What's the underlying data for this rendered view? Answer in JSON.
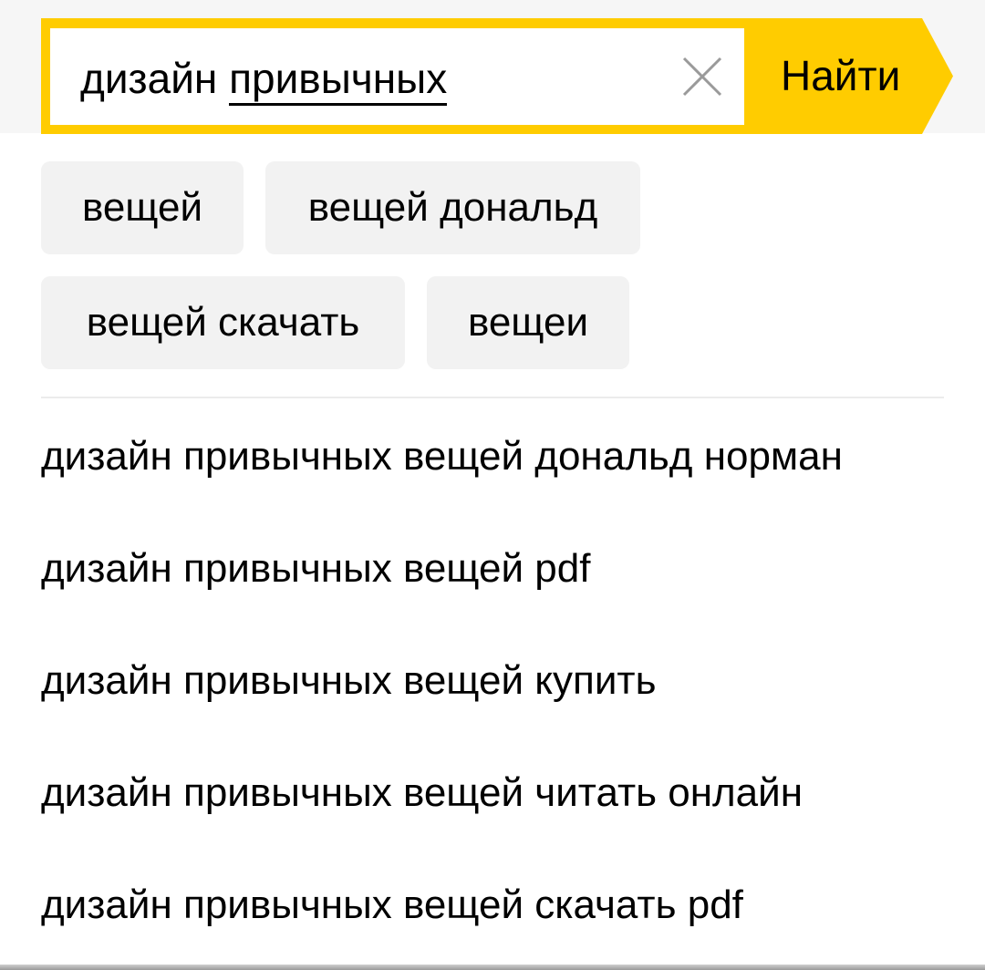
{
  "search": {
    "query_prefix": "дизайн ",
    "query_current_word": "привычных",
    "find_label": "Найти",
    "accent_color": "#ffcc00"
  },
  "icons": {
    "clear": "close-icon"
  },
  "chips": [
    {
      "label": "вещей"
    },
    {
      "label": "вещей дональд"
    },
    {
      "label": "вещей скачать"
    },
    {
      "label": "вещеи"
    }
  ],
  "suggestions": [
    {
      "text": "дизайн привычных вещей дональд норман"
    },
    {
      "text": "дизайн привычных вещей pdf"
    },
    {
      "text": "дизайн привычных вещей купить"
    },
    {
      "text": "дизайн привычных вещей читать онлайн"
    },
    {
      "text": "дизайн привычных вещей скачать pdf"
    }
  ]
}
